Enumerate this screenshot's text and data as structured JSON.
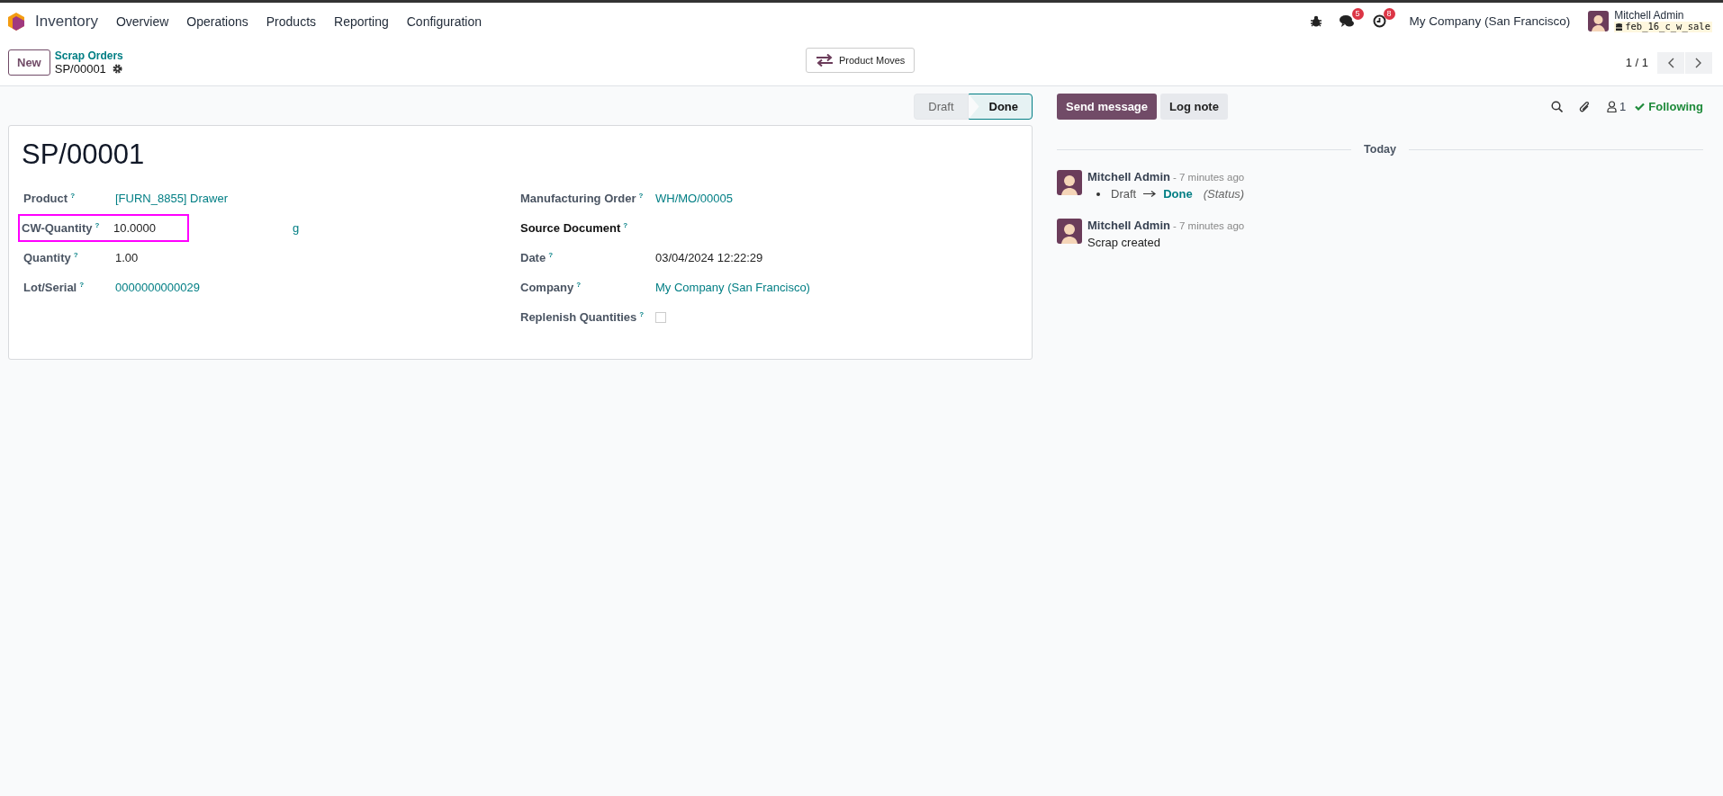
{
  "navbar": {
    "app_name": "Inventory",
    "menu": [
      "Overview",
      "Operations",
      "Products",
      "Reporting",
      "Configuration"
    ],
    "messages_badge": "5",
    "activities_badge": "8",
    "company": "My Company (San Francisco)",
    "user": "Mitchell Admin",
    "database": "feb_16_c_w_sale"
  },
  "control_panel": {
    "new_button": "New",
    "breadcrumb_parent": "Scrap Orders",
    "breadcrumb_current": "SP/00001",
    "action_button": "Product Moves",
    "pager": "1 / 1"
  },
  "statusbar": [
    {
      "label": "Draft",
      "selected": false
    },
    {
      "label": "Done",
      "selected": true
    }
  ],
  "record": {
    "title": "SP/00001",
    "left_fields": [
      {
        "label": "Product",
        "help": "?",
        "kind": "link",
        "value": "[FURN_8855] Drawer",
        "bold": false,
        "highlighted": false
      },
      {
        "label": "CW-Quantity",
        "help": "?",
        "kind": "text",
        "value": "10.0000",
        "unit": "g",
        "bold": false,
        "highlighted": true
      },
      {
        "label": "Quantity",
        "help": "?",
        "kind": "text",
        "value": "1.00",
        "bold": false,
        "highlighted": false
      },
      {
        "label": "Lot/Serial",
        "help": "?",
        "kind": "link",
        "value": "0000000000029",
        "bold": false,
        "highlighted": false
      }
    ],
    "right_fields": [
      {
        "label": "Manufacturing Order",
        "help": "?",
        "kind": "link",
        "value": "WH/MO/00005",
        "bold": false,
        "highlighted": false
      },
      {
        "label": "Source Document",
        "help": "?",
        "kind": "text",
        "bold": true,
        "highlighted": false
      },
      {
        "label": "Date",
        "help": "?",
        "kind": "text",
        "value": "03/04/2024 12:22:29",
        "bold": false,
        "highlighted": false
      },
      {
        "label": "Company",
        "help": "?",
        "kind": "link",
        "value": "My Company (San Francisco)",
        "bold": false,
        "highlighted": false
      },
      {
        "label": "Replenish Quantities",
        "help": "?",
        "kind": "checkbox",
        "checked": false,
        "bold": false,
        "highlighted": false
      }
    ]
  },
  "chatter": {
    "send_button": "Send message",
    "log_button": "Log note",
    "follower_count": "1",
    "following": "Following",
    "date_divider": "Today",
    "messages": [
      {
        "author": "Mitchell Admin",
        "time": "- 7 minutes ago",
        "kind": "tracking",
        "old_value": "Draft",
        "new_value": "Done",
        "field": "(Status)"
      },
      {
        "author": "Mitchell Admin",
        "time": "- 7 minutes ago",
        "kind": "text",
        "body": "Scrap created"
      }
    ]
  }
}
